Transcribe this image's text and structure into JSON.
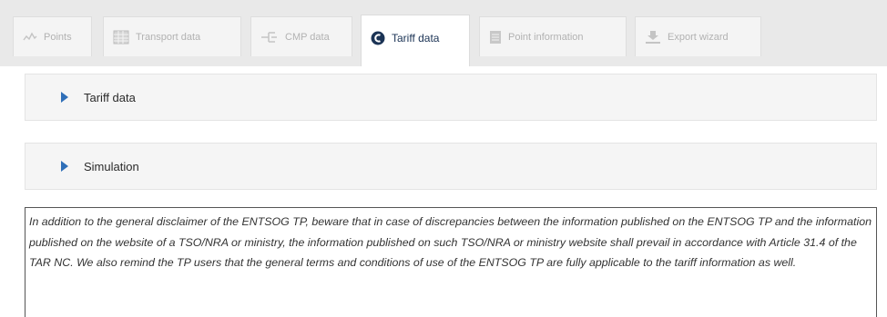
{
  "tabs": [
    {
      "label": "Points",
      "icon": "points-icon",
      "active": false
    },
    {
      "label": "Transport data",
      "icon": "table-icon",
      "active": false
    },
    {
      "label": "CMP data",
      "icon": "cmp-icon",
      "active": false
    },
    {
      "label": "Tariff data",
      "icon": "tariff-icon",
      "active": true
    },
    {
      "label": "Point information",
      "icon": "info-doc-icon",
      "active": false
    },
    {
      "label": "Export wizard",
      "icon": "download-icon",
      "active": false
    }
  ],
  "panels": [
    {
      "title": "Tariff data",
      "icon": "expand-arrow-icon"
    },
    {
      "title": "Simulation",
      "icon": "expand-arrow-icon"
    }
  ],
  "disclaimer": {
    "text": "In addition to the general disclaimer of the ENTSOG TP, beware that in case of discrepancies between the information published on the ENTSOG TP and the information published on the website of a TSO/NRA or ministry, the information published on such TSO/NRA or ministry website shall prevail in accordance with Article 31.4 of the TAR NC. We also remind the TP users that the general terms and conditions of use of the ENTSOG TP are fully applicable to the tariff information as well."
  },
  "colors": {
    "accent": "#2f6fb8",
    "active_tab_text": "#1b3355",
    "inactive_tab_text": "#b2b2b2"
  }
}
